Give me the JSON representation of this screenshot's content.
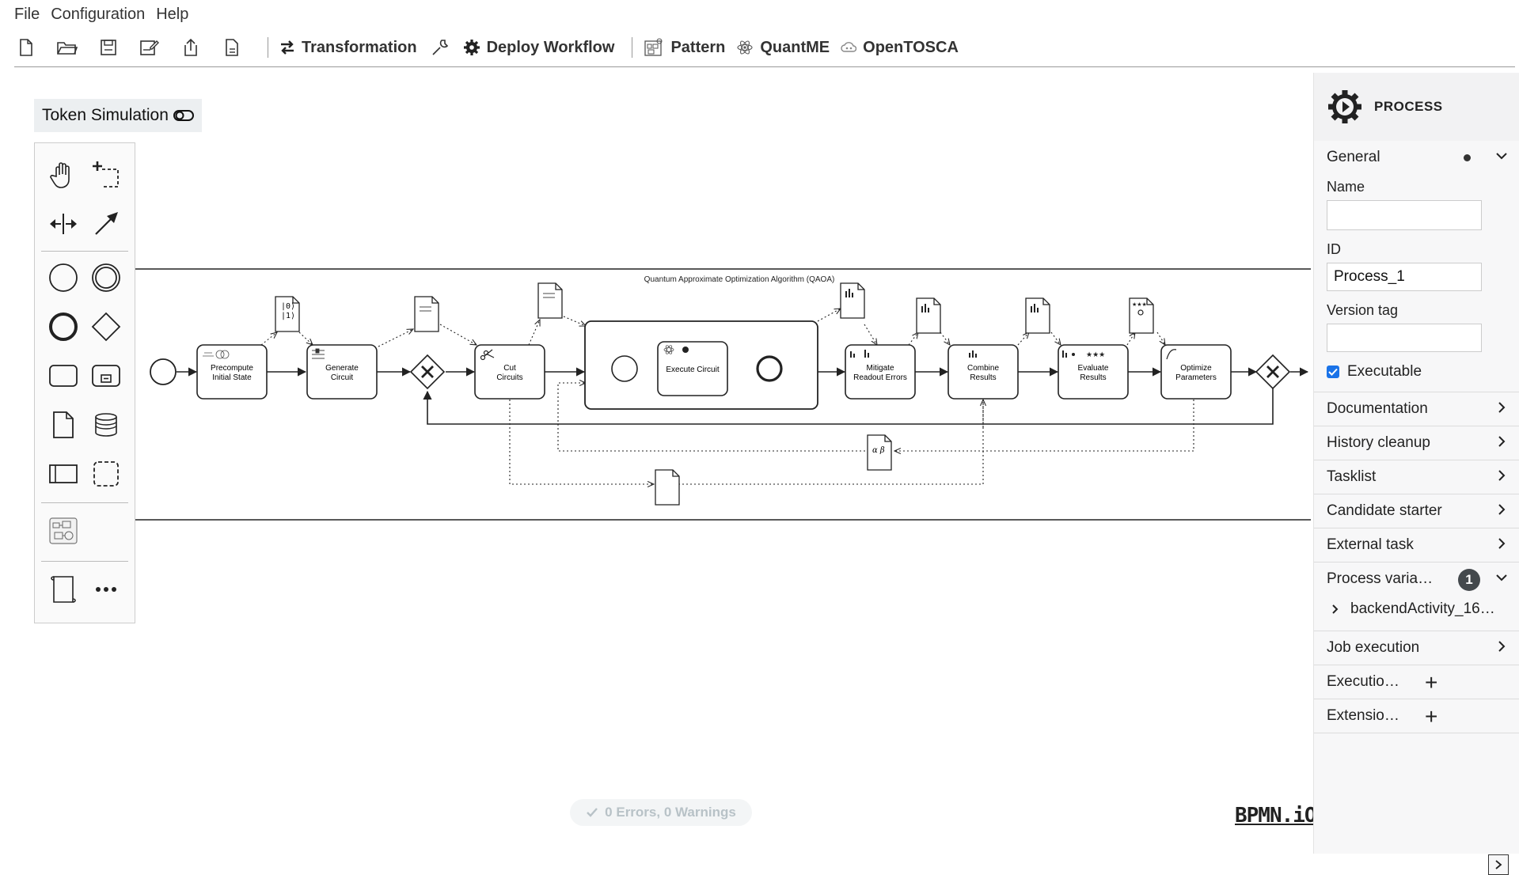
{
  "menu": {
    "file": "File",
    "configuration": "Configuration",
    "help": "Help"
  },
  "toolbar": {
    "transformation": "Transformation",
    "deploy_workflow": "Deploy Workflow",
    "pattern": "Pattern",
    "quantme": "QuantME",
    "opentosca": "OpenTOSCA"
  },
  "token_simulation": {
    "label": "Token Simulation"
  },
  "diagram": {
    "pool_title": "Quantum Approximate Optimization Algorithm (QAOA)",
    "tasks": {
      "precompute": [
        "Precompute",
        "Initial State"
      ],
      "generate": [
        "Generate",
        "Circuit"
      ],
      "cut": [
        "Cut",
        "Circuits"
      ],
      "execute": [
        "Execute Circuit"
      ],
      "mitigate": [
        "Mitigate",
        "Readout Errors"
      ],
      "combine": [
        "Combine",
        "Results"
      ],
      "evaluate": [
        "Evaluate",
        "Results"
      ],
      "optimize": [
        "Optimize",
        "Parameters"
      ]
    },
    "data_object_state_text": [
      "|0⟩",
      "|1⟩"
    ],
    "data_object_params_text": "α β"
  },
  "status": {
    "text": "0 Errors, 0 Warnings"
  },
  "brand": {
    "text": "BPMN.iO"
  },
  "panel": {
    "title": "PROCESS",
    "general": {
      "label": "General",
      "name_label": "Name",
      "name_value": "",
      "id_label": "ID",
      "id_value": "Process_1",
      "version_label": "Version tag",
      "version_value": "",
      "executable_label": "Executable"
    },
    "sections": {
      "documentation": "Documentation",
      "history_cleanup": "History cleanup",
      "tasklist": "Tasklist",
      "candidate_starter": "Candidate starter",
      "external_task": "External task",
      "process_variables": "Process varia…",
      "process_variables_count": "1",
      "process_variable_item": "backendActivity_16…",
      "job_execution": "Job execution",
      "execution_listeners": "Executio…",
      "extension_properties": "Extensio…"
    }
  },
  "colors": {
    "accent": "#1a73e8",
    "stroke": "#222222"
  }
}
